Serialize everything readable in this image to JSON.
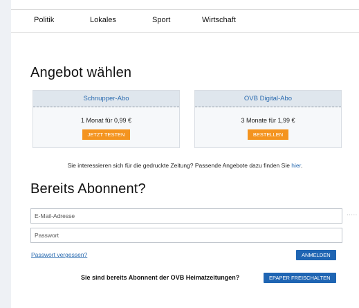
{
  "nav": {
    "items": [
      "Politik",
      "Lokales",
      "Sport",
      "Wirtschaft"
    ]
  },
  "offer": {
    "heading": "Angebot wählen",
    "cards": [
      {
        "title": "Schnupper-Abo",
        "price": "1 Monat für 0,99 €",
        "cta": "JETZT TESTEN"
      },
      {
        "title": "OVB Digital-Abo",
        "price": "3 Monate für 1,99 €",
        "cta": "BESTELLEN"
      }
    ],
    "print_text": "Sie interessieren sich für die gedruckte Zeitung? Passende Angebote dazu finden Sie ",
    "print_link": "hier",
    "print_end": "."
  },
  "login": {
    "heading": "Bereits Abonnent?",
    "email_placeholder": "E-Mail-Adresse",
    "password_placeholder": "Passwort",
    "forgot_link": "Passwort vergessen?",
    "login_button": "ANMELDEN",
    "more_dots": "·····"
  },
  "epaper": {
    "question": "Sie sind bereits Abonnent der OVB Heimatzeitungen?",
    "button": "EPAPER FREISCHALTEN"
  },
  "colors": {
    "accent_orange": "#f4941f",
    "accent_blue": "#1f65b3",
    "link_blue": "#2a6bb0"
  }
}
